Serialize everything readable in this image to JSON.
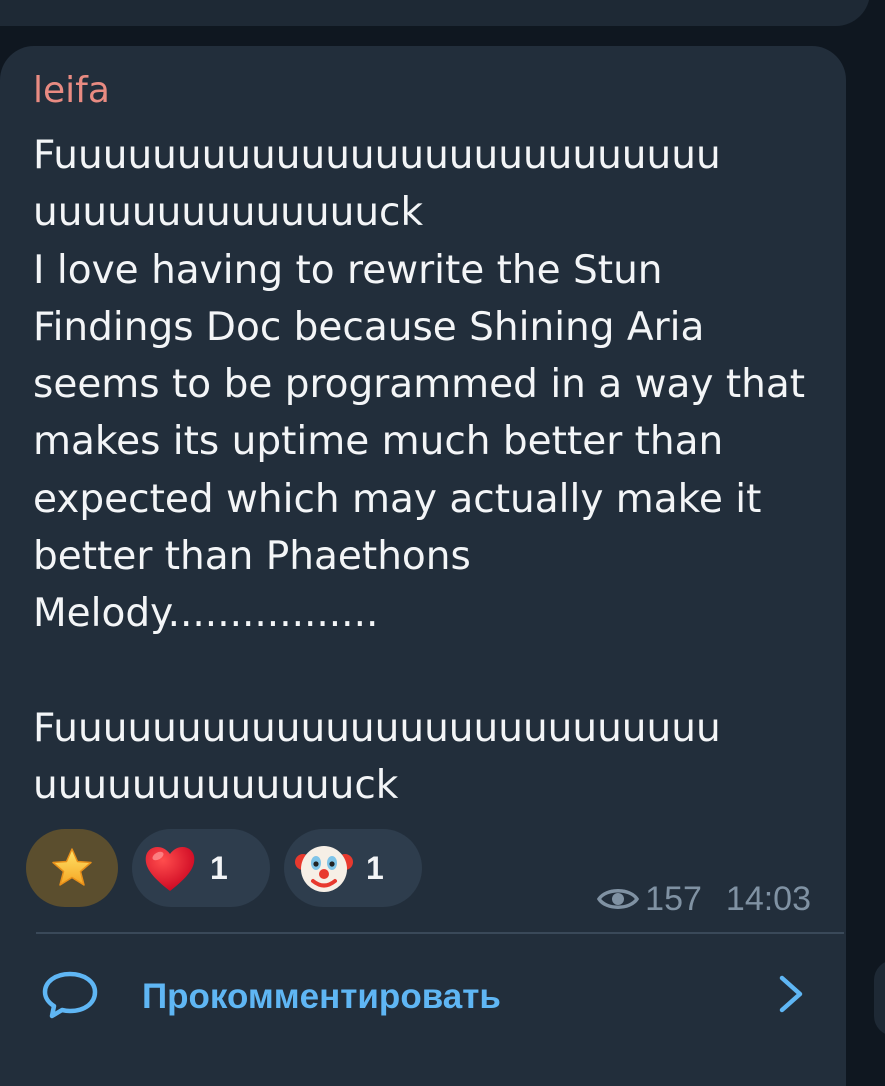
{
  "message": {
    "sender": "leifa",
    "text": "Fuuuuuuuuuuuuuuuuuuuuuuuuuuu uuuuuuuuuuuuuuck\nI love having to rewrite the Stun Findings Doc because Shining Aria seems to be programmed in a way that makes its uptime much better than expected which may actually make it better than Phaethons Melody.................\n\nFuuuuuuuuuuuuuuuuuuuuuuuuuuu uuuuuuuuuuuuuck"
  },
  "reactions": [
    {
      "emoji": "star",
      "count": ""
    },
    {
      "emoji": "red-heart",
      "count": "1"
    },
    {
      "emoji": "clown-face",
      "count": "1"
    }
  ],
  "meta": {
    "views": "157",
    "time": "14:03"
  },
  "comment_bar": {
    "label": "Прокомментировать"
  },
  "colors": {
    "sender_name": "#e98b82",
    "link_accent": "#5fb6f4",
    "bubble": "#222e3b"
  }
}
